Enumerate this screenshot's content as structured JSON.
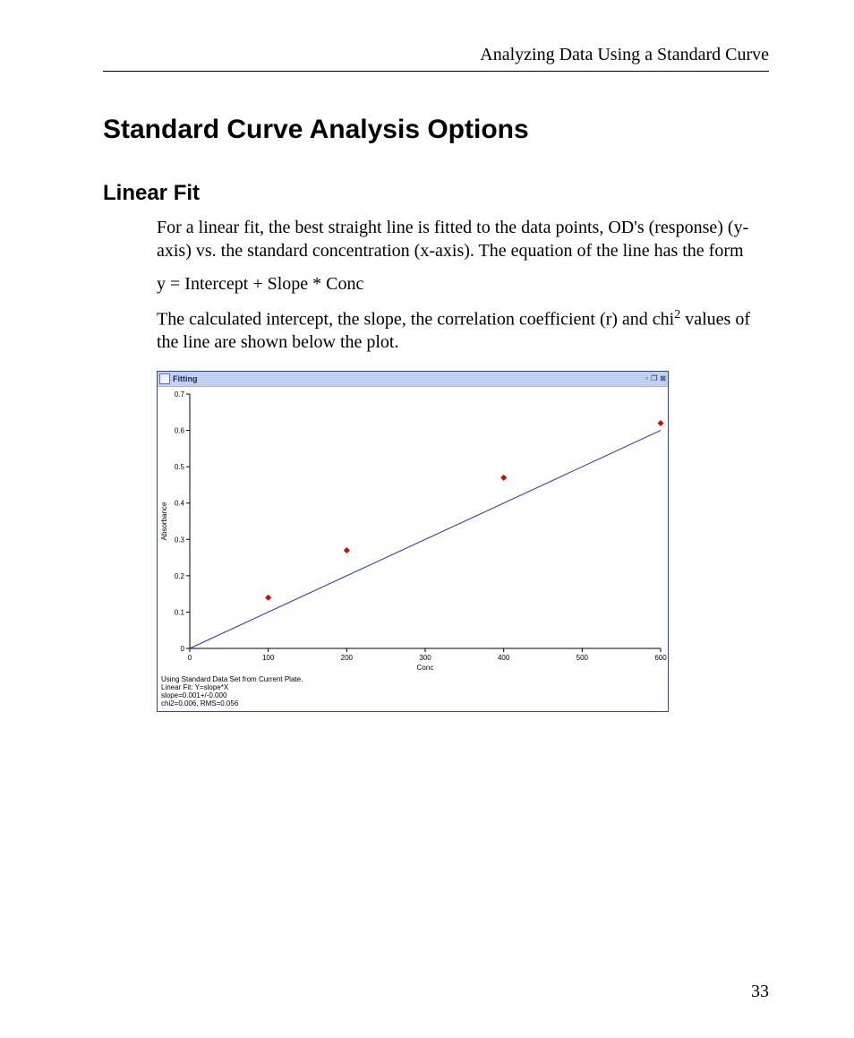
{
  "header": {
    "running_head": "Analyzing Data Using a Standard Curve"
  },
  "title": "Standard Curve Analysis Options",
  "section": {
    "heading": "Linear Fit",
    "p1": "For a linear fit, the best straight line is fitted to the data points, OD's (response) (y-axis) vs. the standard concentration (x-axis).  The equation of the line has the form",
    "equation": "y = Intercept + Slope * Conc",
    "p2a": "The calculated intercept, the slope, the correlation coefficient (r) and chi",
    "p2sup": "2",
    "p2b": " values of the line are shown below the plot."
  },
  "chart_window": {
    "title": "Fitting",
    "btn_min": "▫",
    "btn_max": "❐",
    "btn_close": "⊠"
  },
  "chart_data": {
    "type": "scatter",
    "x": [
      100,
      200,
      400,
      600
    ],
    "y": [
      0.14,
      0.27,
      0.47,
      0.62
    ],
    "line": {
      "slope": 0.001,
      "intercept": 0.0,
      "x0": 0,
      "x1": 600
    },
    "xlabel": "Conc",
    "ylabel": "Absorbance",
    "xlim": [
      0,
      600
    ],
    "ylim": [
      0,
      0.7
    ],
    "xticks": [
      0,
      100,
      200,
      300,
      400,
      500,
      600
    ],
    "yticks": [
      0,
      0.1,
      0.2,
      0.3,
      0.4,
      0.5,
      0.6,
      0.7
    ],
    "footer_lines": [
      "Using Standard Data Set from Current Plate.",
      "Linear Fit: Y=slope*X",
      "slope=0.001+/-0.000",
      "chi2=0.006, RMS=0.056"
    ]
  },
  "page_number": "33"
}
